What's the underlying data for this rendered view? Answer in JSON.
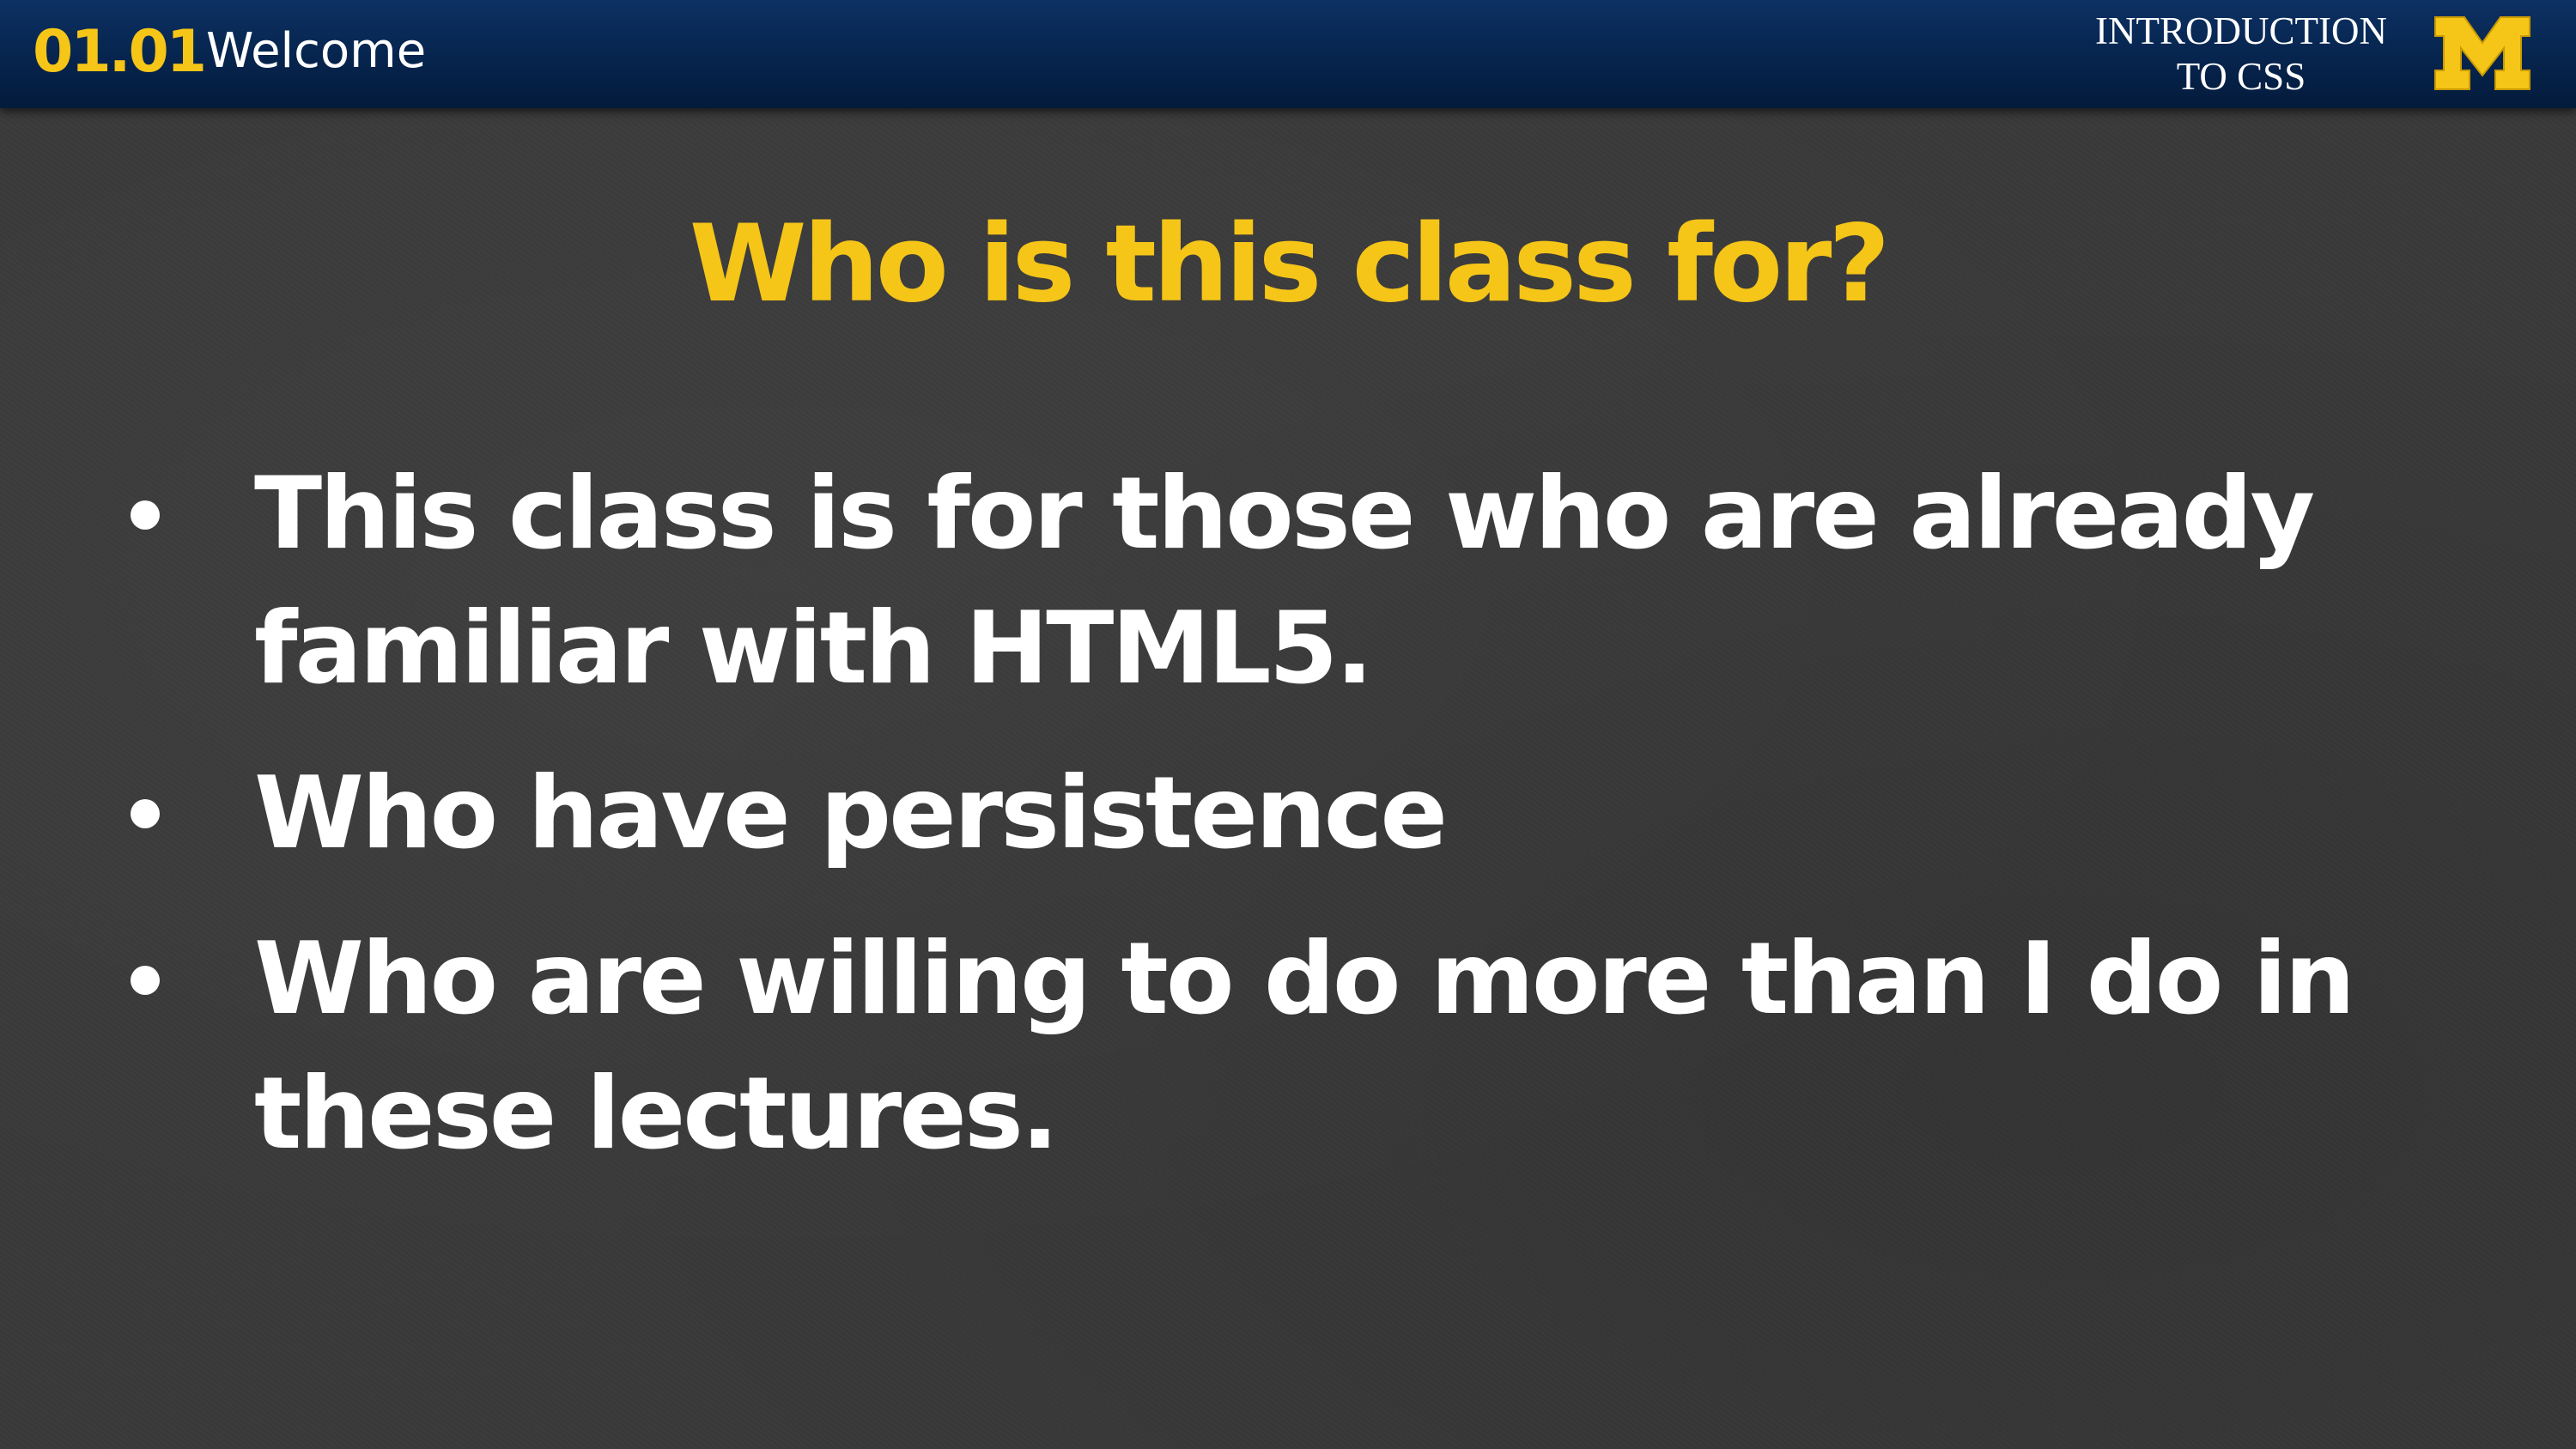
{
  "header": {
    "lecture_number": "01.01",
    "lecture_title": "Welcome",
    "course_title_line1": "INTRODUCTION",
    "course_title_line2": "TO CSS",
    "logo_text": "M",
    "logo_icon": "block-m-logo"
  },
  "slide": {
    "title": "Who is this class for?",
    "bullets": [
      {
        "line1": "This class is for those who are already",
        "line2": "familiar with HTML5."
      },
      {
        "line1": "Who have persistence"
      },
      {
        "line1": "Who are willing to do more than I do in",
        "line2": "these lectures."
      }
    ]
  },
  "colors": {
    "accent": "#f5c518",
    "header_bg": "#06244d",
    "slide_bg": "#3a3a3a",
    "text": "#ffffff"
  }
}
